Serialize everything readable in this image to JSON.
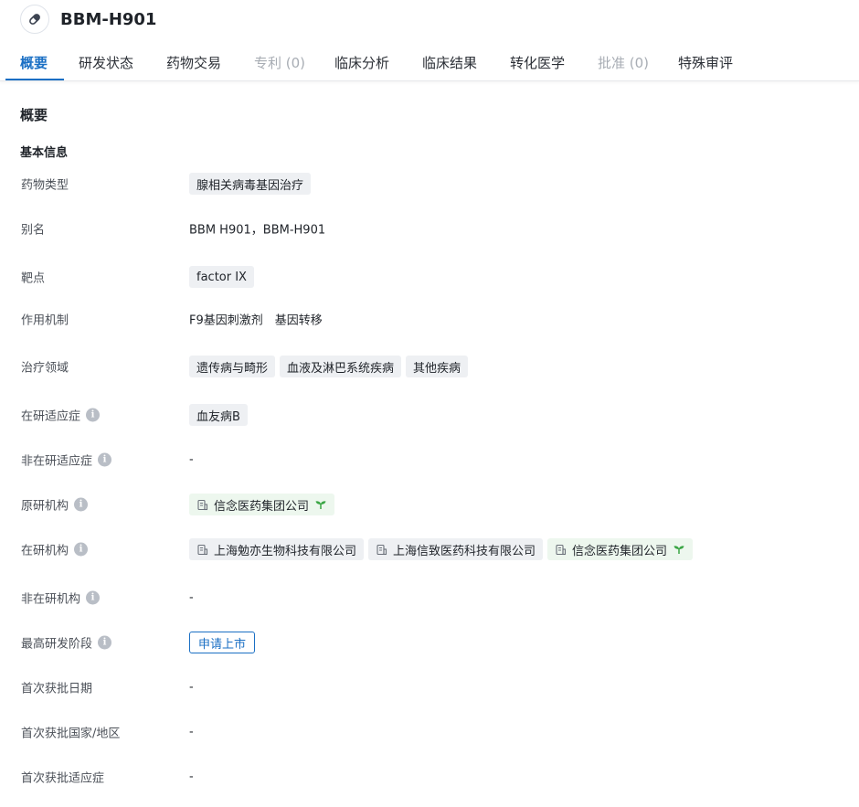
{
  "header": {
    "title": "BBM-H901",
    "icon": "pill-icon"
  },
  "tabs": [
    {
      "label": "概要",
      "state": "active"
    },
    {
      "label": "研发状态",
      "state": "normal"
    },
    {
      "label": "药物交易",
      "state": "normal"
    },
    {
      "label": "专利 (0)",
      "state": "disabled"
    },
    {
      "label": "临床分析",
      "state": "normal"
    },
    {
      "label": "临床结果",
      "state": "normal"
    },
    {
      "label": "转化医学",
      "state": "normal"
    },
    {
      "label": "批准 (0)",
      "state": "disabled"
    },
    {
      "label": "特殊审评",
      "state": "normal"
    }
  ],
  "section": {
    "title": "概要",
    "subtitle": "基本信息"
  },
  "fields": {
    "drug_type": {
      "label": "药物类型",
      "tags": [
        "腺相关病毒基因治疗"
      ]
    },
    "alias": {
      "label": "别名",
      "value": "BBM H901，BBM-H901"
    },
    "target": {
      "label": "靶点",
      "tags": [
        "factor IX"
      ]
    },
    "mechanism": {
      "label": "作用机制",
      "items": [
        "F9基因刺激剂",
        "基因转移"
      ]
    },
    "therapy_area": {
      "label": "治疗领域",
      "tags": [
        "遗传病与畸形",
        "血液及淋巴系统疾病",
        "其他疾病"
      ]
    },
    "active_indication": {
      "label": "在研适应症",
      "tags": [
        "血友病B"
      ]
    },
    "inactive_indication": {
      "label": "非在研适应症",
      "value": "-"
    },
    "originator": {
      "label": "原研机构",
      "orgs": [
        {
          "name": "信念医药集团公司",
          "sprout": true
        }
      ]
    },
    "active_org": {
      "label": "在研机构",
      "orgs": [
        {
          "name": "上海勉亦生物科技有限公司",
          "sprout": false
        },
        {
          "name": "上海信致医药科技有限公司",
          "sprout": false
        },
        {
          "name": "信念医药集团公司",
          "sprout": true
        }
      ]
    },
    "inactive_org": {
      "label": "非在研机构",
      "value": "-"
    },
    "highest_phase": {
      "label": "最高研发阶段",
      "value": "申请上市"
    },
    "first_approval_date": {
      "label": "首次获批日期",
      "value": "-"
    },
    "first_approval_country": {
      "label": "首次获批国家/地区",
      "value": "-"
    },
    "first_approval_indication": {
      "label": "首次获批适应症",
      "value": "-"
    }
  },
  "colors": {
    "accent": "#1a6fc4",
    "tag_bg": "#eef0f3",
    "org_green_bg": "#edf7ee",
    "sprout": "#3aa544",
    "disabled": "#a8adb4"
  }
}
